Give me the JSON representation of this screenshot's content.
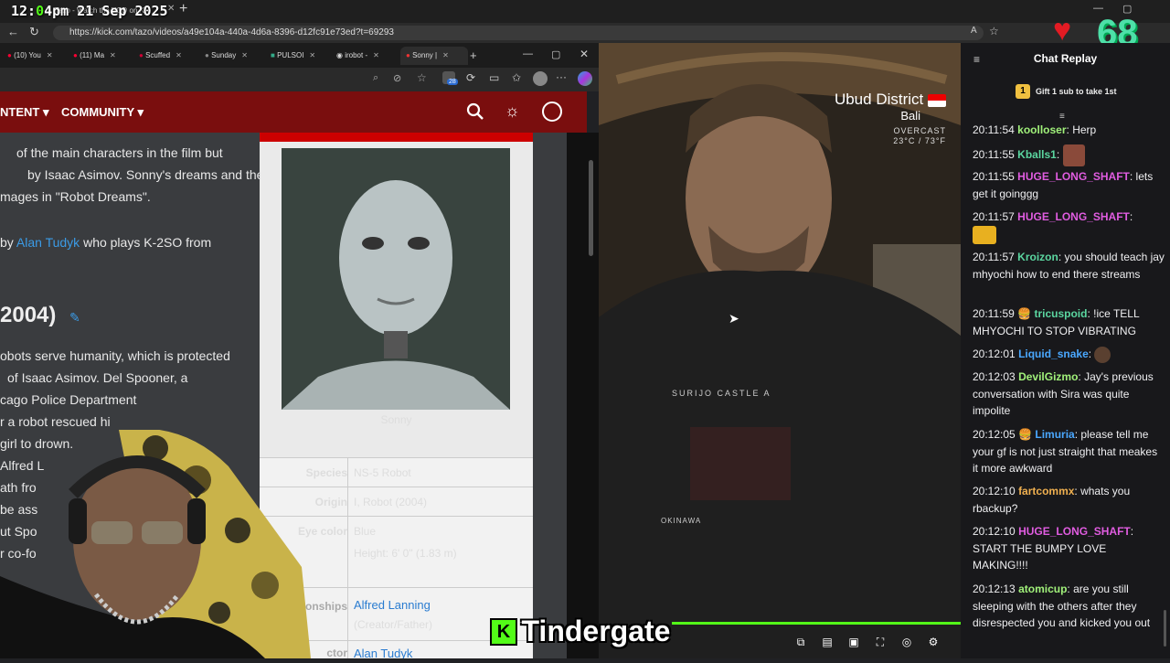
{
  "overlay": {
    "time": "12:04pm 21 Sep 2025",
    "time_part1": "12:",
    "time_k": "0",
    "time_part2": "4pm  21 Sep 2025",
    "big_number": "68"
  },
  "outer_browser": {
    "tab_title": "Tazo - Watch the VOD on Ki",
    "url": "https://kick.com/tazo/videos/a49e104a-440a-4d6a-8396-d12fc91e73ed?t=69293"
  },
  "inner_browser": {
    "tabs": [
      {
        "label": "(10) You"
      },
      {
        "label": "(11) Ma"
      },
      {
        "label": "Scuffed"
      },
      {
        "label": "Sunday"
      },
      {
        "label": "PULSOI"
      },
      {
        "label": "irobot -"
      },
      {
        "label": "Sonny |"
      }
    ],
    "extension_badge": "28"
  },
  "wiki": {
    "nav": {
      "content": "NTENT",
      "community": "COMMUNITY"
    },
    "para1": [
      {
        "text": "of the main characters in the film but"
      },
      {
        "text": "by Isaac Asimov. Sonny's dreams and the"
      },
      {
        "text": "mages in \"Robot Dreams\"."
      }
    ],
    "voiced_prefix": "by",
    "voiced_link": "Alan Tudyk",
    "voiced_suffix": "who plays K-2SO from",
    "section_heading": "2004)",
    "para2": [
      {
        "text": "obots serve humanity, which is protected"
      },
      {
        "text": "of Isaac Asimov. Del Spooner, a"
      },
      {
        "text": "cago Police Department"
      },
      {
        "text": "r a robot rescued hi"
      },
      {
        "text": "girl to drown."
      },
      {
        "text": "Alfred L"
      },
      {
        "text": "ath fro"
      },
      {
        "text": "be ass"
      },
      {
        "text": "ut Spo"
      },
      {
        "text": "r co-fo"
      }
    ],
    "infobox": {
      "caption": "Sonny",
      "rows": [
        {
          "label": "Species",
          "value": "NS-5 Robot"
        },
        {
          "label": "Origin",
          "value": "I, Robot (2004)"
        },
        {
          "label": "Eye color",
          "value": "Blue"
        },
        {
          "label": "",
          "value": "Height: 6' 0\" (1.83 m)"
        },
        {
          "label": "ionships",
          "value": "Alfred Lanning"
        },
        {
          "label": "",
          "value": "(Creator/Father)"
        },
        {
          "label": "ctor",
          "value": "Alan Tudyk"
        }
      ]
    }
  },
  "video": {
    "location": "Ubud District",
    "region": "Bali",
    "weather": "OVERCAST",
    "temp": "23°C / 73°F",
    "shirt_text_top": "SURIJO CASTLE A",
    "shirt_text_bottom": "OKINAWA"
  },
  "chat": {
    "title": "Chat Replay",
    "gift_text": "Gift 1 sub to take 1st",
    "gift_count": "1",
    "messages": [
      {
        "time": "20:11:54",
        "user": "koolloser",
        "color": "#a0f07a",
        "text": "Herp"
      },
      {
        "time": "20:11:55",
        "user": "Kballs1",
        "color": "#5bd6a0",
        "text": ""
      },
      {
        "time": "20:11:55",
        "user": "HUGE_LONG_SHAFT",
        "color": "#e05ce0",
        "text": "lets get it goinggg"
      },
      {
        "time": "20:11:57",
        "user": "HUGE_LONG_SHAFT",
        "color": "#e05ce0",
        "text": ""
      },
      {
        "time": "20:11:57",
        "user": "Kroizon",
        "color": "#5bd6a0",
        "text": "you should teach jay mhyochi how to end there streams"
      },
      {
        "time": "20:11:59",
        "user": "tricuspoid",
        "color": "#5bd6a0",
        "text": "!ice TELL MHYOCHI TO STOP VIBRATING"
      },
      {
        "time": "20:12:01",
        "user": "Liquid_snake",
        "color": "#4aa8ff",
        "text": ""
      },
      {
        "time": "20:12:03",
        "user": "DevilGizmo",
        "color": "#a0f07a",
        "text": "Jay's previous conversation with Sira was quite impolite"
      },
      {
        "time": "20:12:05",
        "user": "Limuria",
        "color": "#4aa8ff",
        "text": "please tell me your gf is not just straight that meakes it more awkward"
      },
      {
        "time": "20:12:10",
        "user": "fartcommx",
        "color": "#f0b050",
        "text": "whats you rbackup?"
      },
      {
        "time": "20:12:10",
        "user": "HUGE_LONG_SHAFT",
        "color": "#e05ce0",
        "text": "START THE BUMPY LOVE MAKING!!!!"
      },
      {
        "time": "20:12:13",
        "user": "atomicup",
        "color": "#a0f07a",
        "text": "are you still sleeping with the others after they disrespected you and kicked you out"
      }
    ]
  },
  "banner": {
    "text": "Tindergate",
    "logo": "K"
  }
}
